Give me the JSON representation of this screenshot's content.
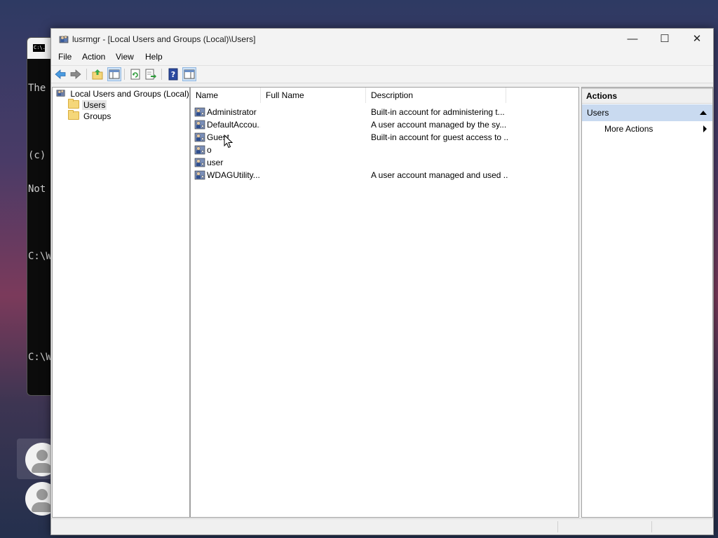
{
  "background_console": {
    "icon_text": "C:\\.",
    "lines": [
      "The",
      "",
      "(c)",
      "Not",
      "",
      "C:\\W",
      "",
      "",
      "C:\\W"
    ]
  },
  "window": {
    "title": "lusrmgr - [Local Users and Groups (Local)\\Users]",
    "controls": {
      "minimize": "—",
      "maximize": "☐",
      "close": "✕"
    }
  },
  "menu": {
    "file": "File",
    "action": "Action",
    "view": "View",
    "help": "Help"
  },
  "tree": {
    "root": "Local Users and Groups (Local)",
    "users": "Users",
    "groups": "Groups"
  },
  "list": {
    "columns": {
      "name": "Name",
      "full_name": "Full Name",
      "description": "Description"
    },
    "rows": [
      {
        "name": "Administrator",
        "full_name": "",
        "description": "Built-in account for administering t..."
      },
      {
        "name": "DefaultAccou...",
        "full_name": "",
        "description": "A user account managed by the sy..."
      },
      {
        "name": "Guest",
        "full_name": "",
        "description": "Built-in account for guest access to ..."
      },
      {
        "name": "o",
        "full_name": "",
        "description": ""
      },
      {
        "name": "user",
        "full_name": "",
        "description": ""
      },
      {
        "name": "WDAGUtility...",
        "full_name": "",
        "description": "A user account managed and used ..."
      }
    ]
  },
  "actions": {
    "header": "Actions",
    "section": "Users",
    "more_actions": "More Actions"
  },
  "colors": {
    "accent": "#c9daf0",
    "selection": "#e5e5e5"
  }
}
